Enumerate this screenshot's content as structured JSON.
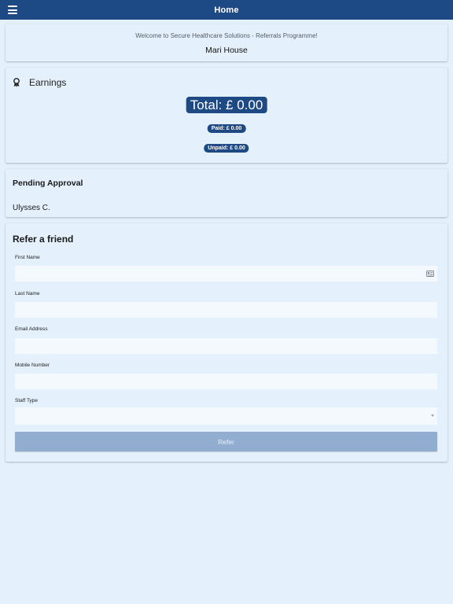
{
  "header": {
    "title": "Home",
    "menu_icon": "hamburger-menu-icon",
    "background_color": "#1d4a84"
  },
  "welcome": {
    "message": "Welcome to Secure Healthcare Solutions - Referrals Programme!",
    "user_name": "Mari House"
  },
  "earnings": {
    "title": "Earnings",
    "icon": "award-icon",
    "total": "Total: £ 0.00",
    "paid": "Paid: £ 0.00",
    "unpaid": "Unpaid: £ 0.00"
  },
  "pending": {
    "title": "Pending Approval",
    "items": [
      "Ulysses C."
    ]
  },
  "refer": {
    "title": "Refer a friend",
    "fields": {
      "first_name": {
        "label": "First Name",
        "value": "",
        "placeholder": ""
      },
      "last_name": {
        "label": "Last Name",
        "value": "",
        "placeholder": ""
      },
      "email": {
        "label": "Email Address",
        "value": "",
        "placeholder": ""
      },
      "mobile": {
        "label": "Mobile Number",
        "value": "",
        "placeholder": ""
      },
      "staff_type": {
        "label": "Staff Type",
        "selected": ""
      }
    },
    "button_label": "Refer",
    "button_color": "#91aed0"
  }
}
